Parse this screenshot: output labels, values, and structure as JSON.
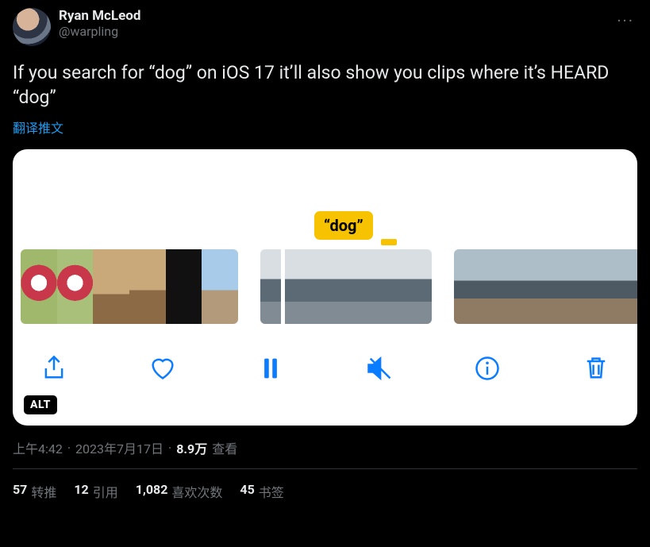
{
  "author": {
    "display_name": "Ryan McLeod",
    "handle": "@warpling"
  },
  "tweet_text": "If you search for “dog” on iOS 17 it’ll also show you clips where it’s HEARD “dog”",
  "translate_label": "翻译推文",
  "media": {
    "tooltip_text": "“dog”",
    "alt_badge": "ALT",
    "toolbar": {
      "share": "share",
      "like": "like",
      "pause": "pause",
      "mute": "mute",
      "info": "info",
      "delete": "delete"
    }
  },
  "meta": {
    "time": "上午4:42",
    "date": "2023年7月17日",
    "views_count": "8.9万",
    "views_label": "查看"
  },
  "stats": {
    "retweets": {
      "count": "57",
      "label": "转推"
    },
    "quotes": {
      "count": "12",
      "label": "引用"
    },
    "likes": {
      "count": "1,082",
      "label": "喜欢次数"
    },
    "bookmarks": {
      "count": "45",
      "label": "书签"
    }
  }
}
